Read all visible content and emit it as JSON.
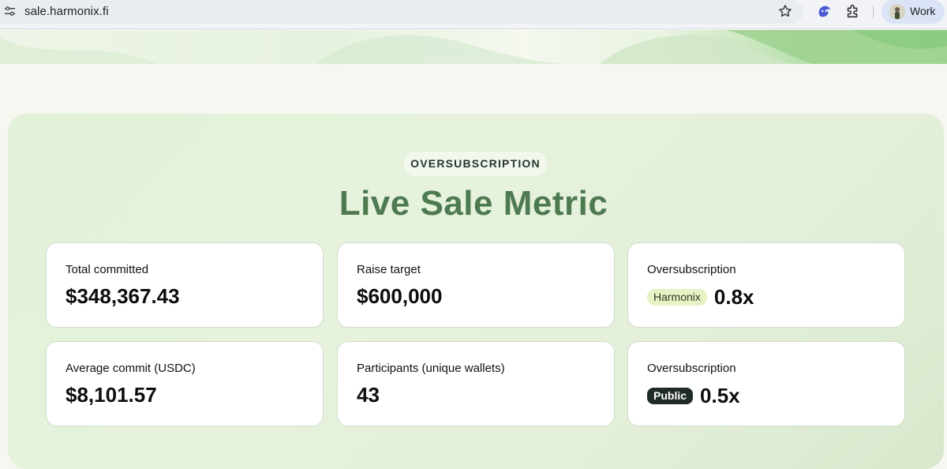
{
  "browser": {
    "url": "sale.harmonix.fi",
    "profile_name": "Work"
  },
  "section": {
    "badge": "OVERSUBSCRIPTION",
    "title": "Live Sale Metric"
  },
  "metrics": [
    {
      "label": "Total committed",
      "value": "$348,367.43"
    },
    {
      "label": "Raise target",
      "value": "$600,000"
    },
    {
      "label": "Oversubscription",
      "tag": "Harmonix",
      "value": "0.8x"
    },
    {
      "label": "Average commit (USDC)",
      "value": "$8,101.57"
    },
    {
      "label": "Participants (unique wallets)",
      "value": "43"
    },
    {
      "label": "Oversubscription",
      "tag": "Public",
      "value": "0.5x"
    }
  ],
  "colors": {
    "title_green": "#4d7a51",
    "panel_green": "#e3f1d8",
    "harmonix_tag": "#e6f3c4",
    "public_tag": "#1f2b27"
  }
}
